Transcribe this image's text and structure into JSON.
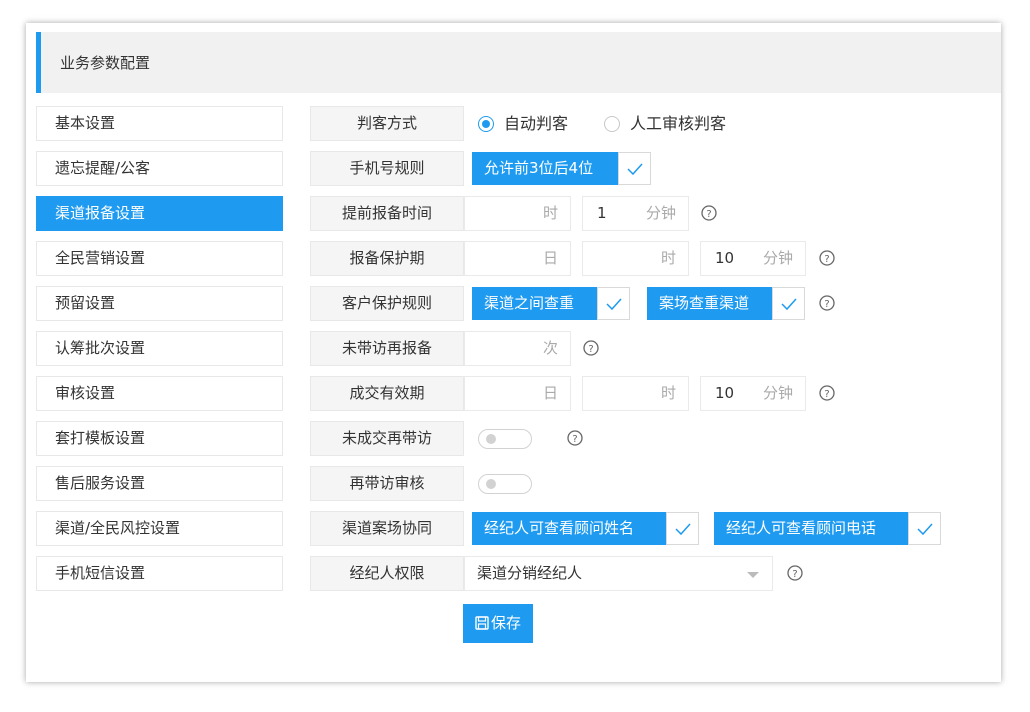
{
  "header": {
    "title": "业务参数配置"
  },
  "sidebar": {
    "items": [
      {
        "label": "基本设置",
        "active": false
      },
      {
        "label": "遗忘提醒/公客",
        "active": false
      },
      {
        "label": "渠道报备设置",
        "active": true
      },
      {
        "label": "全民营销设置",
        "active": false
      },
      {
        "label": "预留设置",
        "active": false
      },
      {
        "label": "认筹批次设置",
        "active": false
      },
      {
        "label": "审核设置",
        "active": false
      },
      {
        "label": "套打模板设置",
        "active": false
      },
      {
        "label": "售后服务设置",
        "active": false
      },
      {
        "label": "渠道/全民风控设置",
        "active": false
      },
      {
        "label": "手机短信设置",
        "active": false
      }
    ]
  },
  "form": {
    "judge_mode": {
      "label": "判客方式",
      "options": [
        {
          "label": "自动判客",
          "checked": true
        },
        {
          "label": "人工审核判客",
          "checked": false
        }
      ]
    },
    "phone_rule": {
      "label": "手机号规则",
      "tag": "允许前3位后4位",
      "checked": true
    },
    "advance_report_time": {
      "label": "提前报备时间",
      "hour": {
        "value": "",
        "unit": "时"
      },
      "minute": {
        "value": "1",
        "unit": "分钟"
      }
    },
    "report_protection": {
      "label": "报备保护期",
      "day": {
        "value": "",
        "unit": "日"
      },
      "hour": {
        "value": "",
        "unit": "时"
      },
      "minute": {
        "value": "10",
        "unit": "分钟"
      }
    },
    "customer_protection": {
      "label": "客户保护规则",
      "tags": [
        {
          "label": "渠道之间查重",
          "checked": true
        },
        {
          "label": "案场查重渠道",
          "checked": true
        }
      ]
    },
    "no_visit_rereport": {
      "label": "未带访再报备",
      "times": {
        "value": "",
        "unit": "次"
      }
    },
    "deal_validity": {
      "label": "成交有效期",
      "day": {
        "value": "",
        "unit": "日"
      },
      "hour": {
        "value": "",
        "unit": "时"
      },
      "minute": {
        "value": "10",
        "unit": "分钟"
      }
    },
    "unclosed_revisit": {
      "label": "未成交再带访",
      "enabled": false
    },
    "revisit_review": {
      "label": "再带访审核",
      "enabled": false
    },
    "channel_site_coop": {
      "label": "渠道案场协同",
      "tags": [
        {
          "label": "经纪人可查看顾问姓名",
          "checked": true
        },
        {
          "label": "经纪人可查看顾问电话",
          "checked": true
        }
      ]
    },
    "broker_permission": {
      "label": "经纪人权限",
      "selected": "渠道分销经纪人"
    }
  },
  "actions": {
    "save_label": "保存"
  },
  "colors": {
    "accent": "#1e9bf0",
    "label_bg": "#f5f5f5",
    "header_bg": "#f1f1f1"
  },
  "icons": {
    "help": "question-circle-icon",
    "save": "floppy-disk-icon",
    "check": "checkmark-icon",
    "dropdown": "caret-down-icon"
  }
}
